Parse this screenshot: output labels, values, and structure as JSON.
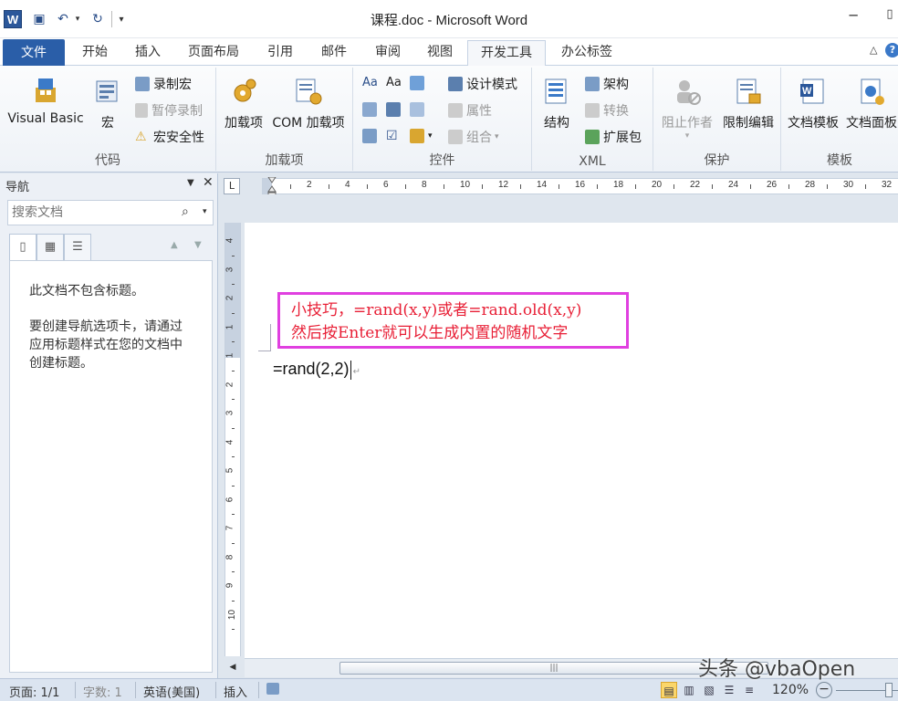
{
  "titlebar": {
    "title": "课程.doc - Microsoft Word",
    "app_icon_letter": "W",
    "minimize": "─",
    "restore": "▯"
  },
  "tabs": [
    {
      "label": "文件"
    },
    {
      "label": "开始"
    },
    {
      "label": "插入"
    },
    {
      "label": "页面布局"
    },
    {
      "label": "引用"
    },
    {
      "label": "邮件"
    },
    {
      "label": "审阅"
    },
    {
      "label": "视图"
    },
    {
      "label": "开发工具"
    },
    {
      "label": "办公标签"
    }
  ],
  "ribbon": {
    "groups": {
      "code": {
        "label": "代码",
        "visual_basic": "Visual Basic",
        "macros": "宏",
        "record_macro": "录制宏",
        "pause_recording": "暂停录制",
        "macro_security": "宏安全性"
      },
      "addins": {
        "label": "加载项",
        "addins": "加载项",
        "com_addins": "COM 加载项"
      },
      "controls": {
        "label": "控件",
        "design_mode": "设计模式",
        "properties": "属性",
        "group": "组合",
        "aa1": "Aa",
        "aa2": "Aa"
      },
      "xml": {
        "label": "XML",
        "structure": "结构",
        "schema": "架构",
        "transform": "转换",
        "expansion_pack": "扩展包"
      },
      "protect": {
        "label": "保护",
        "block_authors": "阻止作者",
        "restrict_editing": "限制编辑"
      },
      "templates": {
        "label": "模板",
        "document_template": "文档模板",
        "document_panel": "文档面板"
      }
    }
  },
  "nav": {
    "title": "导航",
    "search_placeholder": "搜索文档",
    "msg1": "此文档不包含标题。",
    "msg2": "要创建导航选项卡，请通过应用标题样式在您的文档中创建标题。"
  },
  "ruler": {
    "corner": "L",
    "h_numbers": [
      "2",
      "4",
      "6",
      "8",
      "10",
      "12",
      "14",
      "16",
      "18",
      "20",
      "22",
      "24",
      "26",
      "28",
      "30",
      "32"
    ],
    "v_numbers": [
      "4",
      "3",
      "2",
      "1",
      "1",
      "2",
      "3",
      "4",
      "5",
      "6",
      "7",
      "8",
      "9",
      "10"
    ]
  },
  "document": {
    "tip_line1": "小技巧，=rand(x,y)或者=rand.old(x,y)",
    "tip_line2": "然后按Enter就可以生成内置的随机文字",
    "body_text": "=rand(2,2)",
    "accent_color": "#e040e0",
    "tip_text_color": "#e81f36"
  },
  "statusbar": {
    "page": "页面: 1/1",
    "words": "字数: 1",
    "language": "英语(美国)",
    "insert_mode": "插入",
    "zoom": "120%"
  },
  "watermark": "头条 @vbaOpen"
}
